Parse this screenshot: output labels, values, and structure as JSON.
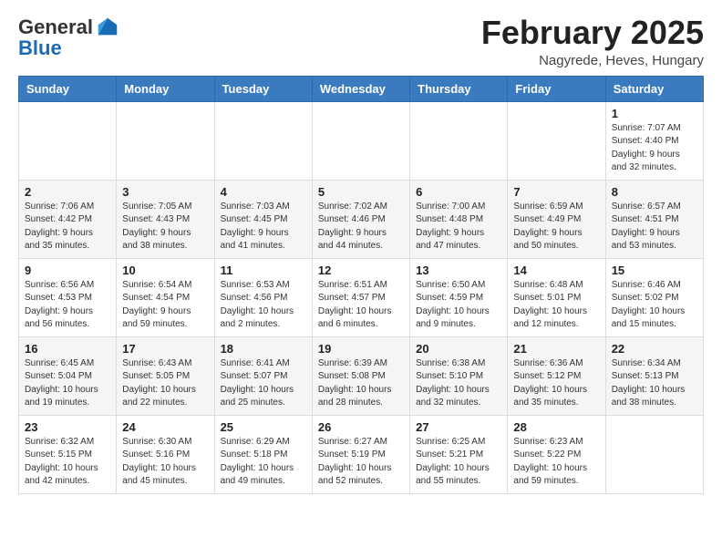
{
  "header": {
    "logo_general": "General",
    "logo_blue": "Blue",
    "month_title": "February 2025",
    "location": "Nagyrede, Heves, Hungary"
  },
  "weekdays": [
    "Sunday",
    "Monday",
    "Tuesday",
    "Wednesday",
    "Thursday",
    "Friday",
    "Saturday"
  ],
  "weeks": [
    [
      {
        "day": "",
        "info": ""
      },
      {
        "day": "",
        "info": ""
      },
      {
        "day": "",
        "info": ""
      },
      {
        "day": "",
        "info": ""
      },
      {
        "day": "",
        "info": ""
      },
      {
        "day": "",
        "info": ""
      },
      {
        "day": "1",
        "info": "Sunrise: 7:07 AM\nSunset: 4:40 PM\nDaylight: 9 hours and 32 minutes."
      }
    ],
    [
      {
        "day": "2",
        "info": "Sunrise: 7:06 AM\nSunset: 4:42 PM\nDaylight: 9 hours and 35 minutes."
      },
      {
        "day": "3",
        "info": "Sunrise: 7:05 AM\nSunset: 4:43 PM\nDaylight: 9 hours and 38 minutes."
      },
      {
        "day": "4",
        "info": "Sunrise: 7:03 AM\nSunset: 4:45 PM\nDaylight: 9 hours and 41 minutes."
      },
      {
        "day": "5",
        "info": "Sunrise: 7:02 AM\nSunset: 4:46 PM\nDaylight: 9 hours and 44 minutes."
      },
      {
        "day": "6",
        "info": "Sunrise: 7:00 AM\nSunset: 4:48 PM\nDaylight: 9 hours and 47 minutes."
      },
      {
        "day": "7",
        "info": "Sunrise: 6:59 AM\nSunset: 4:49 PM\nDaylight: 9 hours and 50 minutes."
      },
      {
        "day": "8",
        "info": "Sunrise: 6:57 AM\nSunset: 4:51 PM\nDaylight: 9 hours and 53 minutes."
      }
    ],
    [
      {
        "day": "9",
        "info": "Sunrise: 6:56 AM\nSunset: 4:53 PM\nDaylight: 9 hours and 56 minutes."
      },
      {
        "day": "10",
        "info": "Sunrise: 6:54 AM\nSunset: 4:54 PM\nDaylight: 9 hours and 59 minutes."
      },
      {
        "day": "11",
        "info": "Sunrise: 6:53 AM\nSunset: 4:56 PM\nDaylight: 10 hours and 2 minutes."
      },
      {
        "day": "12",
        "info": "Sunrise: 6:51 AM\nSunset: 4:57 PM\nDaylight: 10 hours and 6 minutes."
      },
      {
        "day": "13",
        "info": "Sunrise: 6:50 AM\nSunset: 4:59 PM\nDaylight: 10 hours and 9 minutes."
      },
      {
        "day": "14",
        "info": "Sunrise: 6:48 AM\nSunset: 5:01 PM\nDaylight: 10 hours and 12 minutes."
      },
      {
        "day": "15",
        "info": "Sunrise: 6:46 AM\nSunset: 5:02 PM\nDaylight: 10 hours and 15 minutes."
      }
    ],
    [
      {
        "day": "16",
        "info": "Sunrise: 6:45 AM\nSunset: 5:04 PM\nDaylight: 10 hours and 19 minutes."
      },
      {
        "day": "17",
        "info": "Sunrise: 6:43 AM\nSunset: 5:05 PM\nDaylight: 10 hours and 22 minutes."
      },
      {
        "day": "18",
        "info": "Sunrise: 6:41 AM\nSunset: 5:07 PM\nDaylight: 10 hours and 25 minutes."
      },
      {
        "day": "19",
        "info": "Sunrise: 6:39 AM\nSunset: 5:08 PM\nDaylight: 10 hours and 28 minutes."
      },
      {
        "day": "20",
        "info": "Sunrise: 6:38 AM\nSunset: 5:10 PM\nDaylight: 10 hours and 32 minutes."
      },
      {
        "day": "21",
        "info": "Sunrise: 6:36 AM\nSunset: 5:12 PM\nDaylight: 10 hours and 35 minutes."
      },
      {
        "day": "22",
        "info": "Sunrise: 6:34 AM\nSunset: 5:13 PM\nDaylight: 10 hours and 38 minutes."
      }
    ],
    [
      {
        "day": "23",
        "info": "Sunrise: 6:32 AM\nSunset: 5:15 PM\nDaylight: 10 hours and 42 minutes."
      },
      {
        "day": "24",
        "info": "Sunrise: 6:30 AM\nSunset: 5:16 PM\nDaylight: 10 hours and 45 minutes."
      },
      {
        "day": "25",
        "info": "Sunrise: 6:29 AM\nSunset: 5:18 PM\nDaylight: 10 hours and 49 minutes."
      },
      {
        "day": "26",
        "info": "Sunrise: 6:27 AM\nSunset: 5:19 PM\nDaylight: 10 hours and 52 minutes."
      },
      {
        "day": "27",
        "info": "Sunrise: 6:25 AM\nSunset: 5:21 PM\nDaylight: 10 hours and 55 minutes."
      },
      {
        "day": "28",
        "info": "Sunrise: 6:23 AM\nSunset: 5:22 PM\nDaylight: 10 hours and 59 minutes."
      },
      {
        "day": "",
        "info": ""
      }
    ]
  ]
}
